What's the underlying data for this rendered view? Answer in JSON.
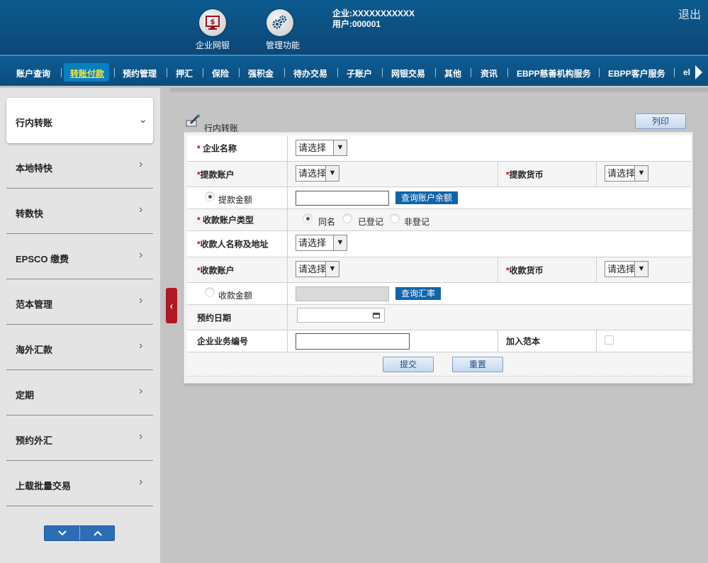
{
  "header": {
    "icons": [
      {
        "label": "企业网银",
        "icon": "monitor-dollar-icon"
      },
      {
        "label": "管理功能",
        "icon": "gears-icon"
      }
    ],
    "enterprise_line": "企业:XXXXXXXXXXX",
    "user_line": "用户:000001",
    "logout": "退出"
  },
  "menu": {
    "items": [
      "账户查询",
      "转账付款",
      "预约管理",
      "押汇",
      "保险",
      "强积金",
      "待办交易",
      "子账户",
      "网银交易",
      "其他",
      "资讯",
      "EBPP慈善机构服务",
      "EBPP客户服务",
      "el"
    ],
    "active_index": 1,
    "active_color": "#f5e63c"
  },
  "sidebar": {
    "items": [
      {
        "label": "行内转账",
        "active": true
      },
      {
        "label": "本地特快"
      },
      {
        "label": "转数快"
      },
      {
        "label": "EPSCO 缴费"
      },
      {
        "label": "范本管理"
      },
      {
        "label": "海外汇款"
      },
      {
        "label": "定期"
      },
      {
        "label": "预约外汇"
      },
      {
        "label": "上载批量交易"
      }
    ],
    "pager_down": "⌄",
    "pager_up": "⌃",
    "collapse": "‹"
  },
  "page": {
    "title": "行内转账",
    "print_button": "列印"
  },
  "form": {
    "required_mark": "*",
    "company_name": {
      "label": " 企业名称",
      "select": "请选择"
    },
    "withdraw_account": {
      "label": "提款账户",
      "select": "请选择"
    },
    "withdraw_currency": {
      "label": "提款货币",
      "select": "请选择"
    },
    "withdraw_amount": {
      "label": "提款金额",
      "value": "",
      "button": "查询账户余额"
    },
    "payee_type": {
      "label": " 收款账户类型",
      "options": [
        "同名",
        "已登记",
        "非登记"
      ],
      "selected": 0
    },
    "payee_name_address": {
      "label": "收款人名称及地址",
      "select": "请选择"
    },
    "payee_account": {
      "label": "收款账户",
      "select": "请选择"
    },
    "payee_currency": {
      "label": "收款货币",
      "select": "请选择"
    },
    "payee_amount": {
      "label": "收款金额",
      "value": "",
      "button": "查询汇率"
    },
    "booking_date": {
      "label": "预约日期",
      "value": ""
    },
    "business_ref": {
      "label": "企业业务编号",
      "value": ""
    },
    "add_template": {
      "label": "加入范本",
      "checked": false
    },
    "submit": "提交",
    "reset": "重置"
  },
  "colors": {
    "header": "#0b5a8e",
    "menubar": "#0b4d7e",
    "required": "#cc0000",
    "collapse_tab": "#b01822",
    "blue_button": "#1164a8"
  }
}
